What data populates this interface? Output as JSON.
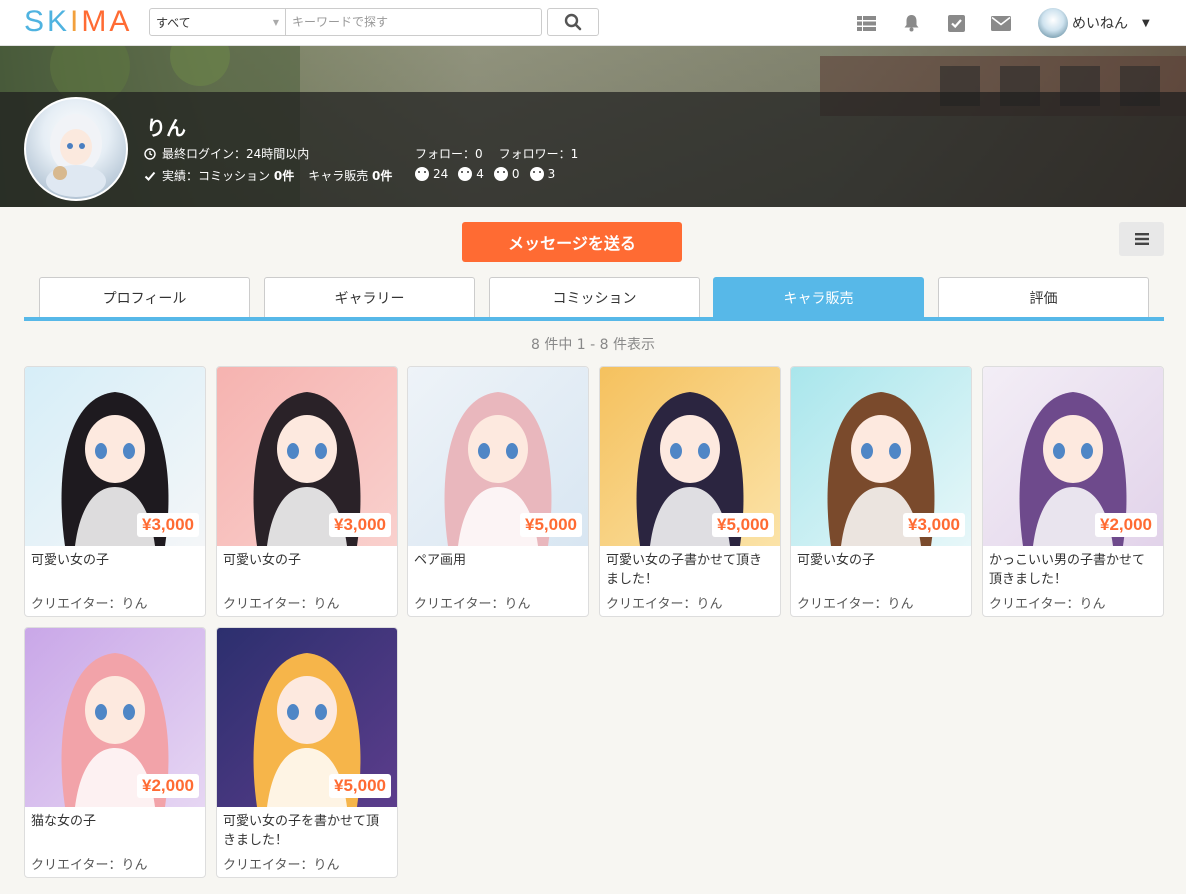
{
  "header": {
    "logo": [
      "S",
      "K",
      "I",
      "M",
      "A"
    ],
    "logo_colors": [
      "#4fb3e0",
      "#4fb3e0",
      "#f2a03c",
      "#ff6b33",
      "#ff6b33"
    ],
    "search_category": "すべて",
    "search_placeholder": "キーワードで探す",
    "icons": [
      "grid-icon",
      "bell-icon",
      "check-square-icon",
      "mail-icon"
    ],
    "user_name": "めいねん"
  },
  "profile": {
    "name": "りん",
    "last_login": "最終ログイン：24時間以内",
    "record_label": "実績：コミッション",
    "commission_count": "0件",
    "chara_label": "キャラ販売",
    "chara_count": "0件",
    "follow": "フォロー：0",
    "follower": "フォロワー：1",
    "ratings": [
      "24",
      "4",
      "0",
      "3"
    ]
  },
  "actions": {
    "message_button": "メッセージを送る"
  },
  "tabs": [
    {
      "label": "プロフィール",
      "active": false
    },
    {
      "label": "ギャラリー",
      "active": false
    },
    {
      "label": "コミッション",
      "active": false
    },
    {
      "label": "キャラ販売",
      "active": true
    },
    {
      "label": "評価",
      "active": false
    }
  ],
  "result_count": "8 件中 1 - 8 件表示",
  "items": [
    {
      "price": "¥3,000",
      "title": "可愛い女の子",
      "creator": "クリエイター：りん",
      "bg": [
        "#d6eef8",
        "#f4f6f8"
      ],
      "accent": "#1e1a1f"
    },
    {
      "price": "¥3,000",
      "title": "可愛い女の子",
      "creator": "クリエイター：りん",
      "bg": [
        "#f6b3b0",
        "#f9d0cd"
      ],
      "accent": "#2a2228"
    },
    {
      "price": "¥5,000",
      "title": "ペア画用",
      "creator": "クリエイター：りん",
      "bg": [
        "#eef3f8",
        "#d8e6f2"
      ],
      "accent": "#e9b7bd"
    },
    {
      "price": "¥5,000",
      "title": "可愛い女の子書かせて頂きました！",
      "creator": "クリエイター：りん",
      "bg": [
        "#f5c15e",
        "#fbe3a8"
      ],
      "accent": "#2b2540"
    },
    {
      "price": "¥3,000",
      "title": "可愛い女の子",
      "creator": "クリエイター：りん",
      "bg": [
        "#a9e6ec",
        "#e7f7f9"
      ],
      "accent": "#7a4a2c"
    },
    {
      "price": "¥2,000",
      "title": "かっこいい男の子書かせて頂きました！",
      "creator": "クリエイター：りん",
      "bg": [
        "#f3eef6",
        "#e2d3ea"
      ],
      "accent": "#6e4a8c"
    },
    {
      "price": "¥2,000",
      "title": "猫な女の子",
      "creator": "クリエイター：りん",
      "bg": [
        "#c9a7e8",
        "#e6d6f3"
      ],
      "accent": "#f2a3a9"
    },
    {
      "price": "¥5,000",
      "title": "可愛い女の子を書かせて頂きました！",
      "creator": "クリエイター：りん",
      "bg": [
        "#2c2f6e",
        "#5c3d8c"
      ],
      "accent": "#f6b54a"
    }
  ]
}
